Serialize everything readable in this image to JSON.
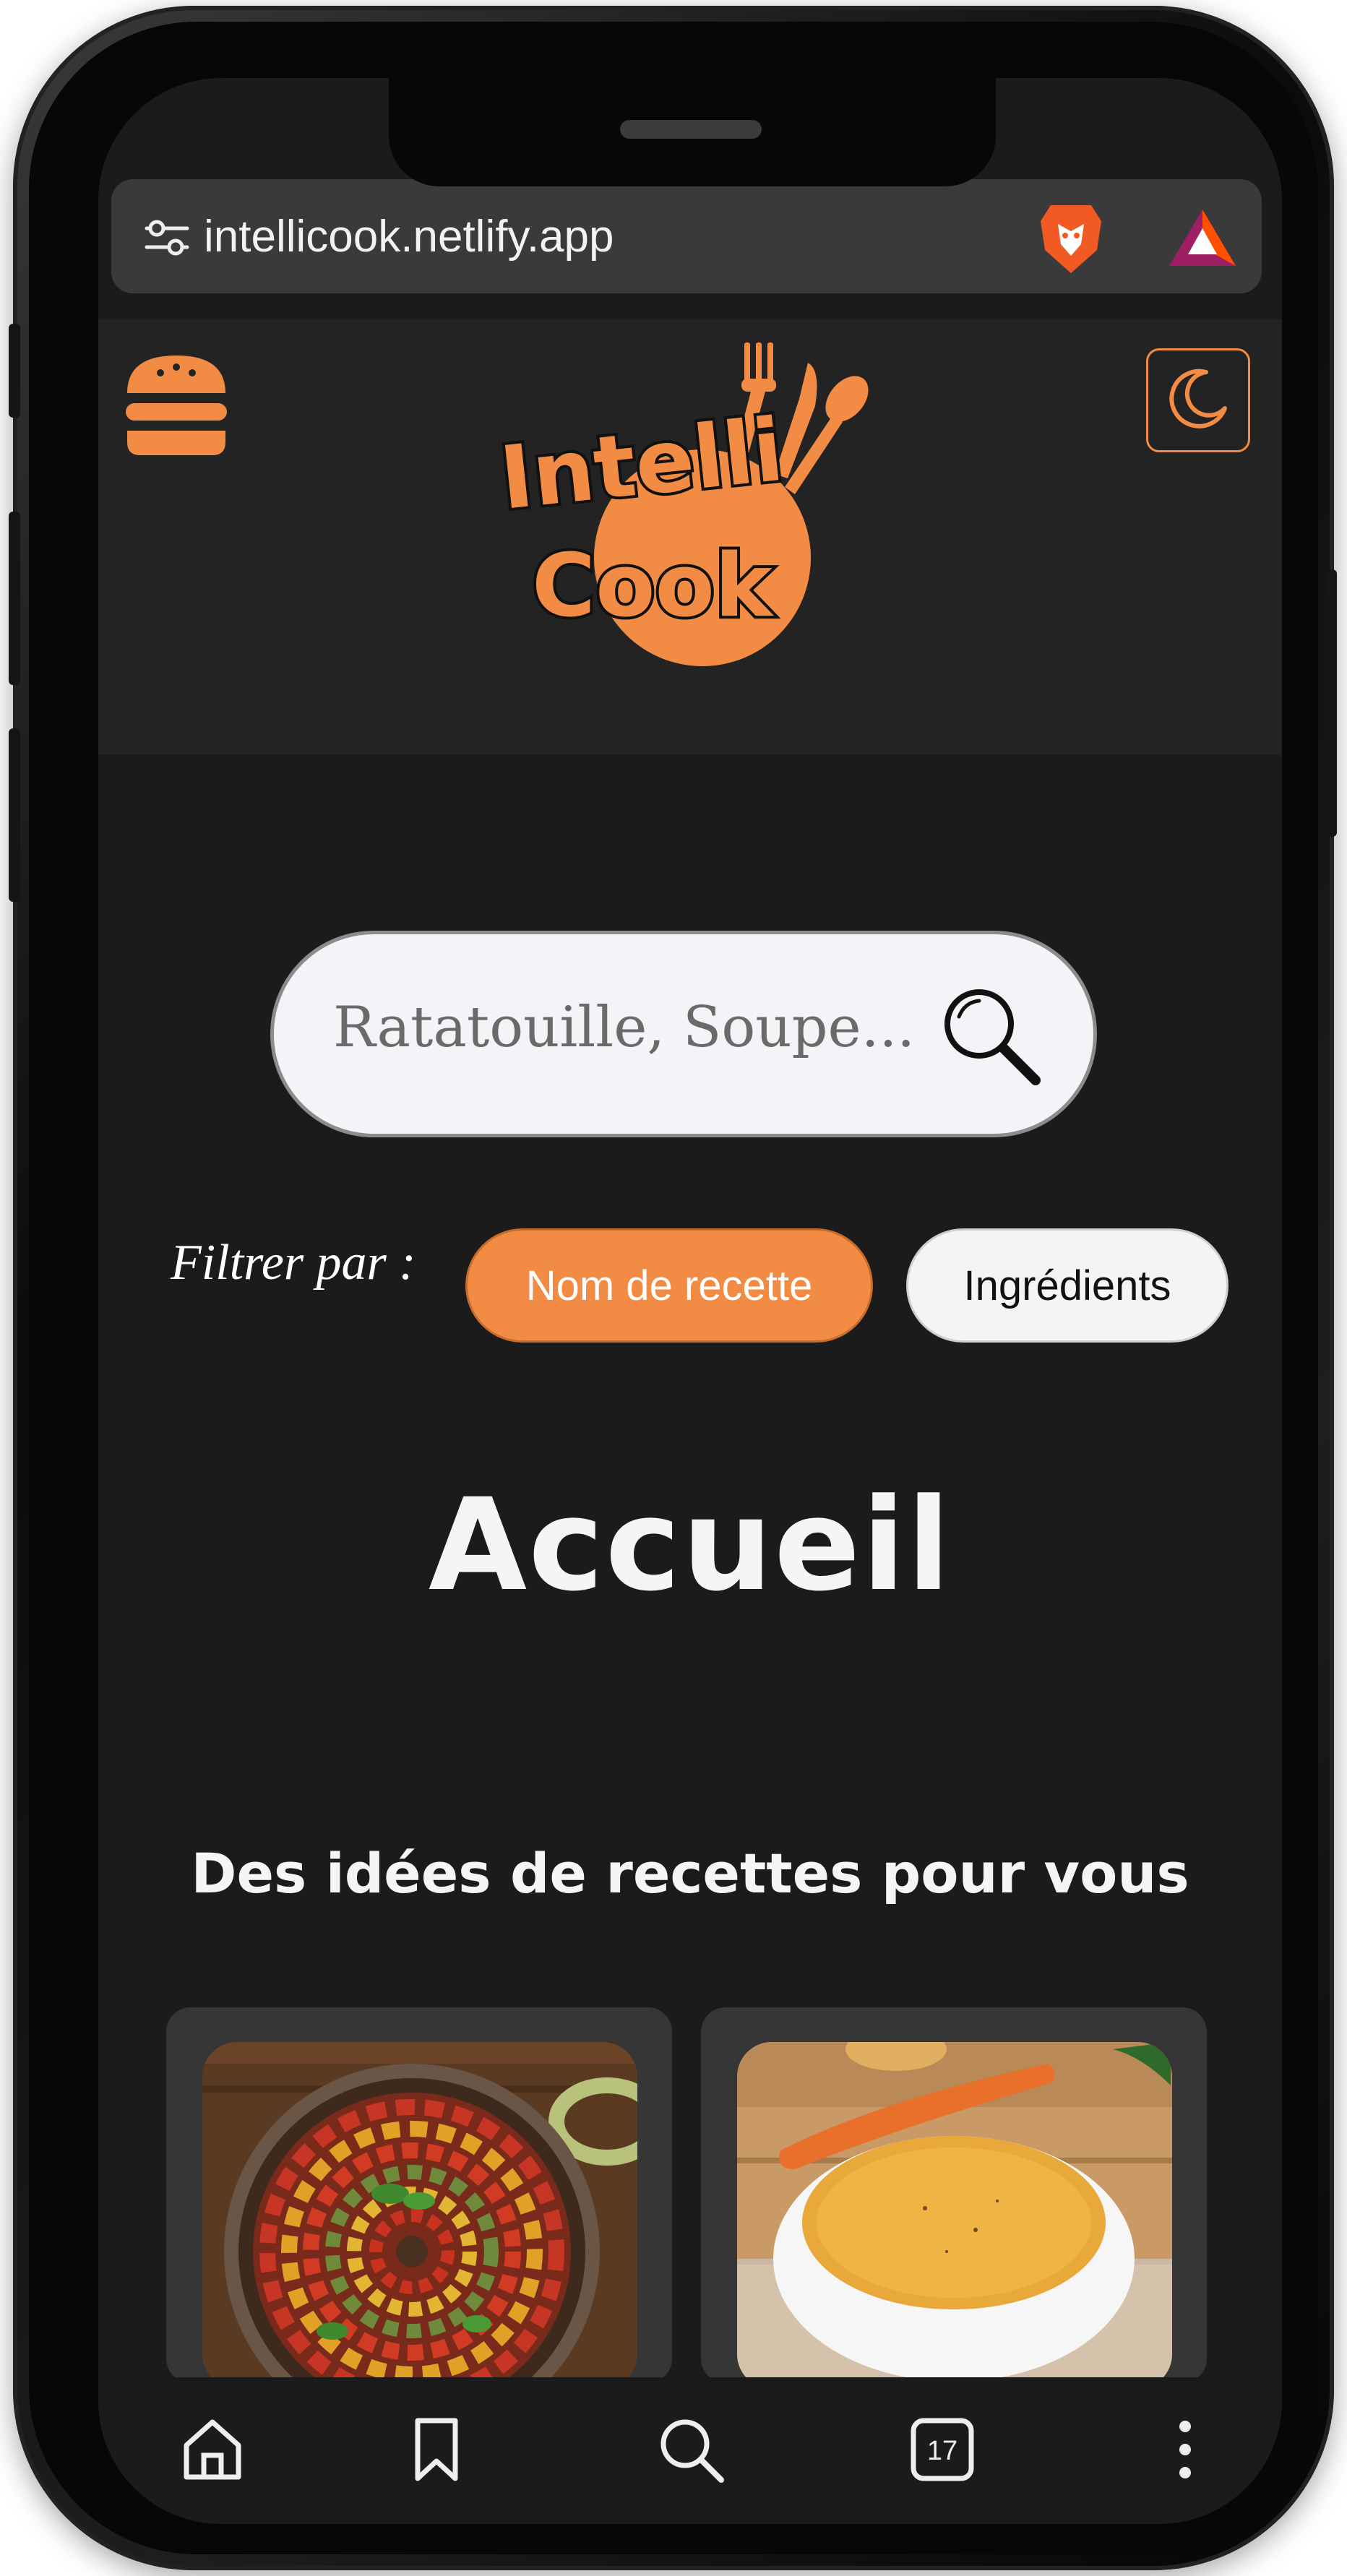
{
  "browser": {
    "url": "intellicook.netlify.app",
    "icons": [
      "tune-icon",
      "brave-lion-icon",
      "bat-triangle-icon"
    ]
  },
  "header": {
    "logo_line1": "Intelli",
    "logo_line2": "Cook",
    "icons": [
      "hamburger-menu-icon",
      "moon-icon"
    ]
  },
  "search": {
    "placeholder": "Ratatouille, Soupe..."
  },
  "filter": {
    "label": "Filtrer par :",
    "options": [
      {
        "label": "Nom de recette",
        "active": true
      },
      {
        "label": "Ingrédients",
        "active": false
      }
    ]
  },
  "main": {
    "title": "Accueil",
    "section_title": "Des idées de recettes pour vous"
  },
  "bottom_nav": {
    "items": [
      "home-icon",
      "bookmark-icon",
      "search-icon",
      "tabs-icon",
      "more-icon"
    ],
    "tab_count": "17"
  },
  "colors": {
    "accent": "#f28b43",
    "background": "#1b1b1b",
    "header_bg": "#232323",
    "card_bg": "#363636"
  }
}
